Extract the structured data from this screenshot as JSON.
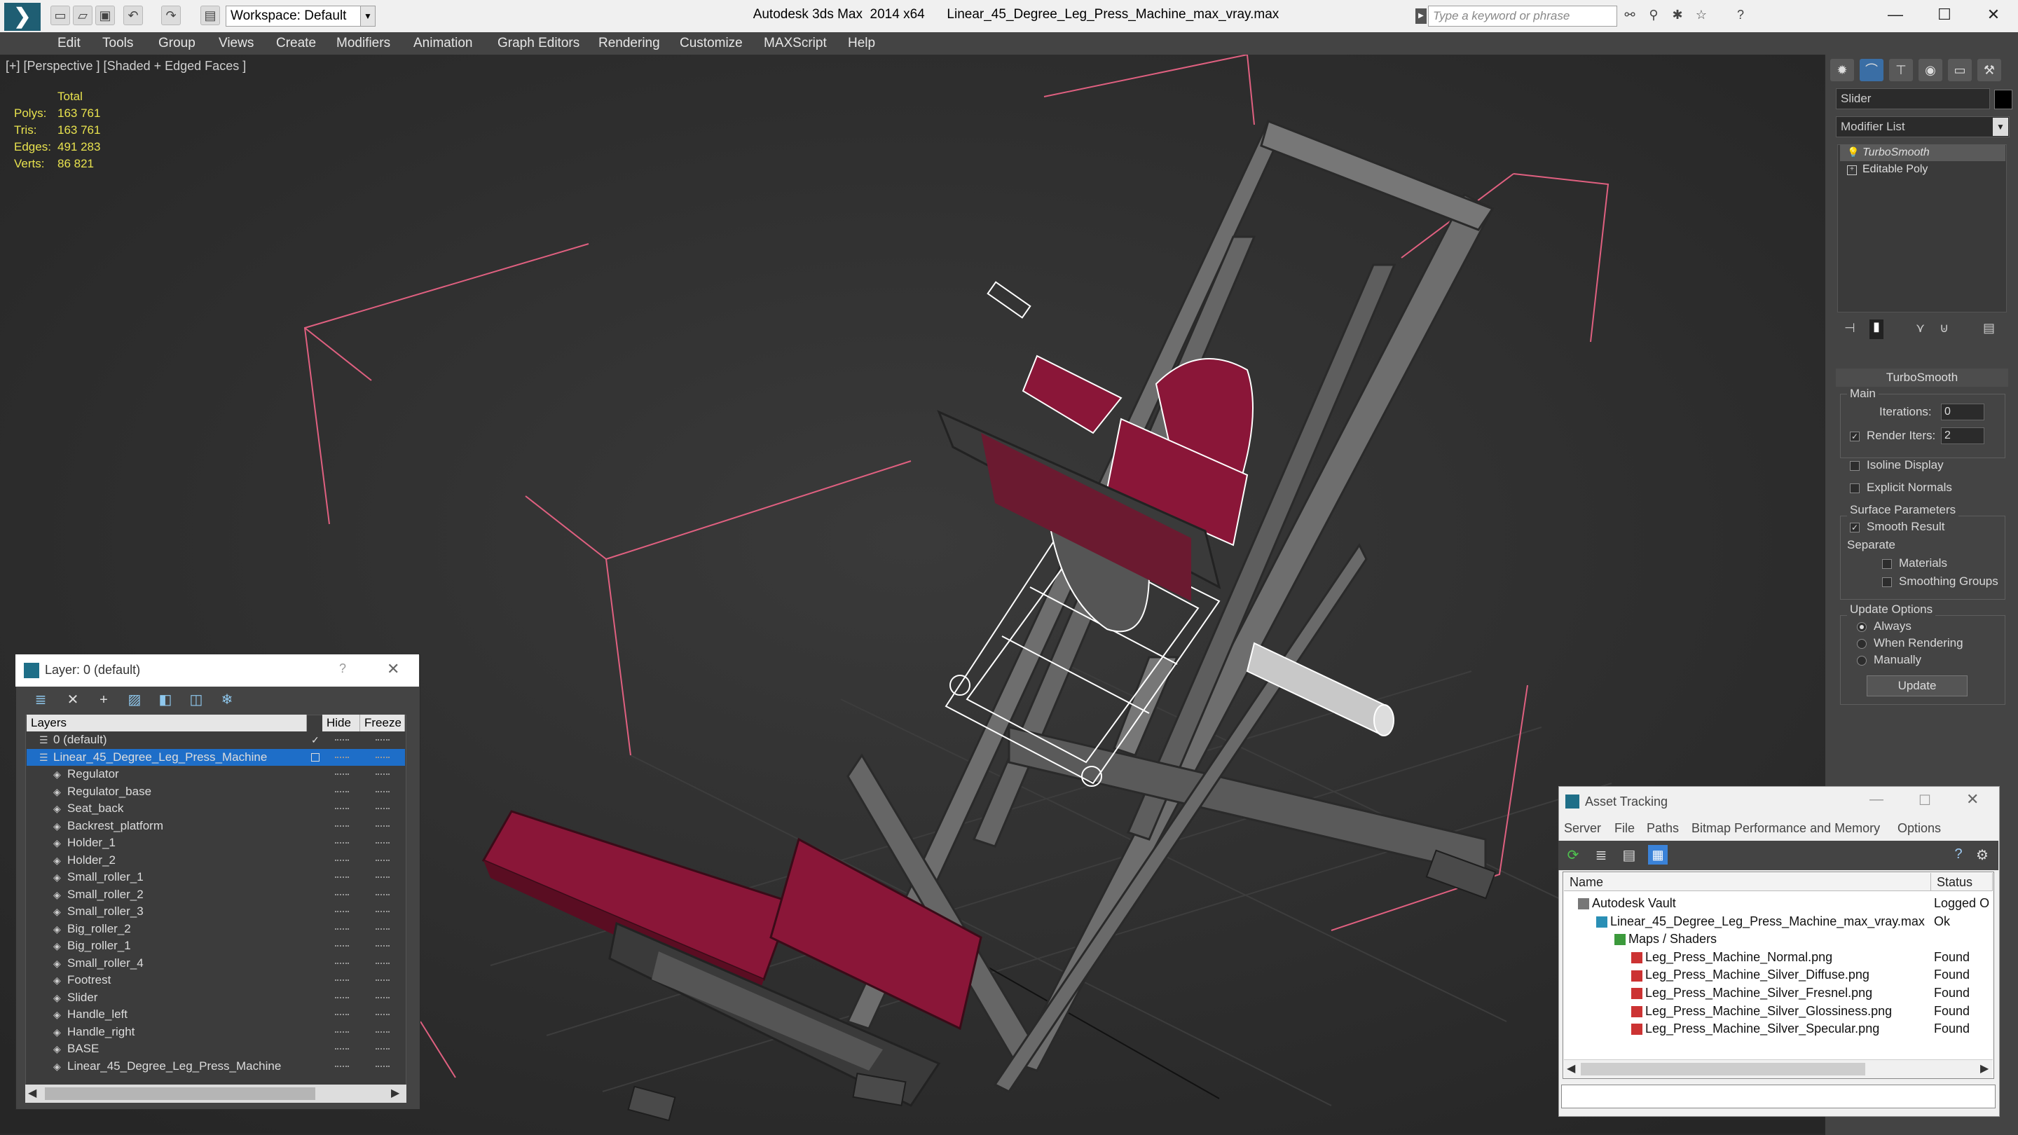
{
  "titlebar": {
    "workspace": "Workspace: Default",
    "app_title": "Autodesk 3ds Max  2014 x64",
    "file_title": "Linear_45_Degree_Leg_Press_Machine_max_vray.max",
    "search_placeholder": "Type a keyword or phrase"
  },
  "menu": [
    "Edit",
    "Tools",
    "Group",
    "Views",
    "Create",
    "Modifiers",
    "Animation",
    "Graph Editors",
    "Rendering",
    "Customize",
    "MAXScript",
    "Help"
  ],
  "viewport": {
    "label": "[+] [Perspective ] [Shaded + Edged Faces ]",
    "stats_header": "Total",
    "stats": [
      {
        "k": "Polys:",
        "v": "163 761"
      },
      {
        "k": "Tris:",
        "v": "163 761"
      },
      {
        "k": "Edges:",
        "v": "491 283"
      },
      {
        "k": "Verts:",
        "v": "86 821"
      }
    ]
  },
  "command_panel": {
    "object_name": "Slider",
    "modifier_list": "Modifier List",
    "stack": [
      "TurboSmooth",
      "Editable Poly"
    ],
    "turbosmooth": {
      "title": "TurboSmooth",
      "main": "Main",
      "iterations_label": "Iterations:",
      "iterations": "0",
      "render_iters_label": "Render Iters:",
      "render_iters": "2",
      "isoline": "Isoline Display",
      "explicit": "Explicit Normals",
      "surface": "Surface Parameters",
      "smooth_result": "Smooth Result",
      "separate": "Separate",
      "materials": "Materials",
      "smoothing_groups": "Smoothing Groups",
      "update_options": "Update Options",
      "always": "Always",
      "when_rendering": "When Rendering",
      "manually": "Manually",
      "update": "Update"
    }
  },
  "layer_window": {
    "title": "Layer: 0 (default)",
    "help": "?",
    "close": "✕",
    "col_layers": "Layers",
    "col_hide": "Hide",
    "col_freeze": "Freeze",
    "rows": [
      "0 (default)",
      "Linear_45_Degree_Leg_Press_Machine",
      "Regulator",
      "Regulator_base",
      "Seat_back",
      "Backrest_platform",
      "Holder_1",
      "Holder_2",
      "Small_roller_1",
      "Small_roller_2",
      "Small_roller_3",
      "Big_roller_2",
      "Big_roller_1",
      "Small_roller_4",
      "Footrest",
      "Slider",
      "Handle_left",
      "Handle_right",
      "BASE",
      "Linear_45_Degree_Leg_Press_Machine"
    ]
  },
  "asset_tracking": {
    "title": "Asset Tracking",
    "menu": [
      "Server",
      "File",
      "Paths",
      "Bitmap Performance and Memory",
      "Options"
    ],
    "col_name": "Name",
    "col_status": "Status",
    "rows": [
      {
        "name": "Autodesk Vault",
        "status": "Logged O"
      },
      {
        "name": "Linear_45_Degree_Leg_Press_Machine_max_vray.max",
        "status": "Ok"
      },
      {
        "name": "Maps / Shaders",
        "status": ""
      },
      {
        "name": "Leg_Press_Machine_Normal.png",
        "status": "Found"
      },
      {
        "name": "Leg_Press_Machine_Silver_Diffuse.png",
        "status": "Found"
      },
      {
        "name": "Leg_Press_Machine_Silver_Fresnel.png",
        "status": "Found"
      },
      {
        "name": "Leg_Press_Machine_Silver_Glossiness.png",
        "status": "Found"
      },
      {
        "name": "Leg_Press_Machine_Silver_Specular.png",
        "status": "Found"
      }
    ]
  },
  "colors": {
    "model_red": "#8a1638",
    "frame_gray": "#6e6e6e",
    "selection_blue": "#1e6ec8",
    "bbox_pink": "#e06080",
    "stats_yellow": "#e8e24e"
  }
}
